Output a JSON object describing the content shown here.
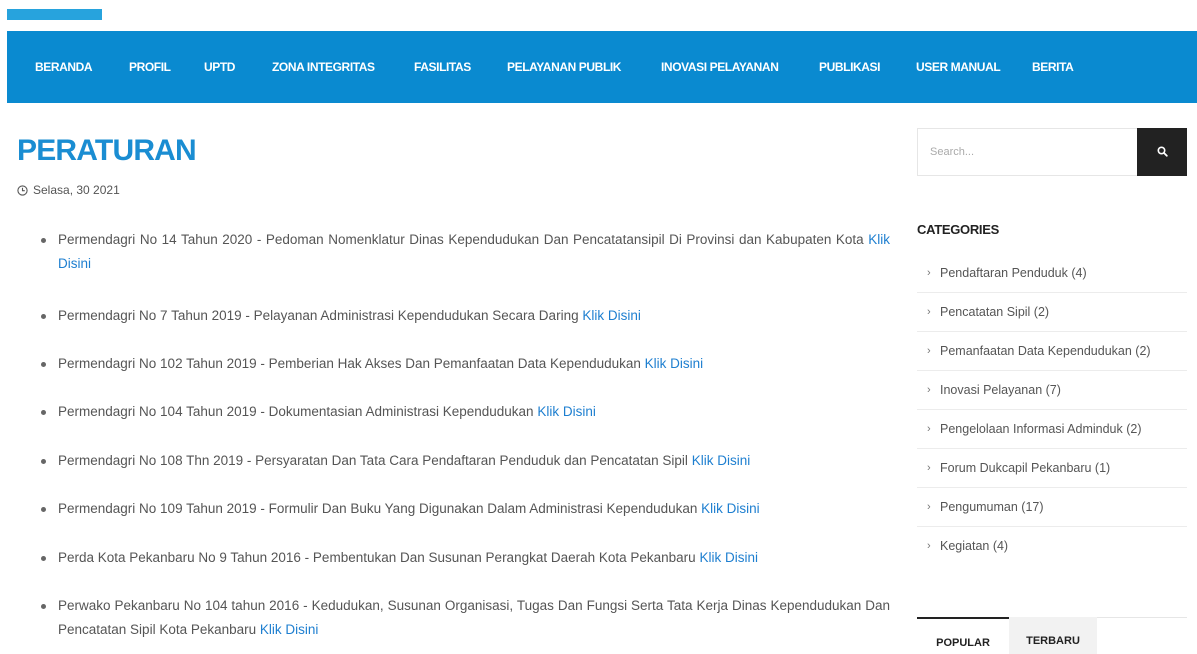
{
  "colors": {
    "nav_bg": "#0a8ad0",
    "title": "#1a8dd2",
    "link": "#1e7fd0",
    "logo": "#27a3dd",
    "search_btn": "#222222"
  },
  "nav": {
    "items": [
      {
        "label": "BERANDA"
      },
      {
        "label": "PROFIL"
      },
      {
        "label": "UPTD"
      },
      {
        "label": "ZONA INTEGRITAS"
      },
      {
        "label": "FASILITAS"
      },
      {
        "label": "PELAYANAN PUBLIK"
      },
      {
        "label": "INOVASI PELAYANAN"
      },
      {
        "label": "PUBLIKASI"
      },
      {
        "label": "USER MANUAL"
      },
      {
        "label": "BERITA"
      }
    ]
  },
  "article": {
    "title": "PERATURAN",
    "date": "Selasa, 30 2021",
    "date_icon": "clock-icon",
    "items": [
      {
        "text": "Permendagri No 14 Tahun 2020 - Pedoman Nomenklatur Dinas Kependudukan Dan Pencatatansipil Di Provinsi dan Kabupaten Kota",
        "link": "Klik Disini"
      },
      {
        "text": "Permendagri No 7 Tahun 2019 - Pelayanan Administrasi Kependudukan Secara Daring",
        "link": "Klik Disini"
      },
      {
        "text": "Permendagri No 102 Tahun 2019 - Pemberian Hak Akses Dan Pemanfaatan Data Kependudukan",
        "link": "Klik Disini"
      },
      {
        "text": "Permendagri No 104 Tahun 2019 - Dokumentasian Administrasi Kependudukan",
        "link": "Klik Disini"
      },
      {
        "text": "Permendagri No 108 Thn 2019 - Persyaratan Dan Tata Cara Pendaftaran Penduduk  dan Pencatatan Sipil",
        "link": "Klik Disini"
      },
      {
        "text": "Permendagri No 109 Tahun 2019 - Formulir Dan Buku Yang Digunakan Dalam Administrasi Kependudukan",
        "link": "Klik Disini"
      },
      {
        "text": "Perda Kota Pekanbaru No 9 Tahun 2016 - Pembentukan Dan Susunan Perangkat Daerah Kota Pekanbaru",
        "link": "Klik Disini"
      },
      {
        "text": "Perwako Pekanbaru No 104 tahun 2016 - Kedudukan, Susunan Organisasi, Tugas Dan Fungsi Serta Tata Kerja Dinas Kependudukan Dan Pencatatan Sipil Kota Pekanbaru",
        "link": "Klik Disini"
      }
    ]
  },
  "sidebar": {
    "search": {
      "placeholder": "Search...",
      "button_icon": "search-icon"
    },
    "categories_heading": "CATEGORIES",
    "categories": [
      {
        "label": "Pendaftaran Penduduk (4)"
      },
      {
        "label": "Pencatatan Sipil (2)"
      },
      {
        "label": "Pemanfaatan Data Kependudukan (2)"
      },
      {
        "label": "Inovasi Pelayanan (7)"
      },
      {
        "label": "Pengelolaan Informasi Adminduk (2)"
      },
      {
        "label": "Forum Dukcapil Pekanbaru (1)"
      },
      {
        "label": "Pengumuman (17)"
      },
      {
        "label": "Kegiatan (4)"
      }
    ],
    "category_icon": "chevron-right-icon",
    "tabs": [
      {
        "label": "POPULAR",
        "active": true
      },
      {
        "label": "TERBARU",
        "active": false
      }
    ]
  }
}
